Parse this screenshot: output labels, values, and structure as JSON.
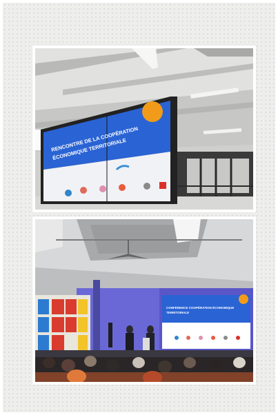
{
  "photos": [
    {
      "name": "conference-screen-photo",
      "screen_text": {
        "badge": "",
        "title_line1": "RENCONTRE DE LA COOPÉRATION",
        "title_line2": "ÉCONOMIQUE TERRITORIALE"
      },
      "colors": {
        "screen_blue": "#2a63d4",
        "badge_orange": "#f29b1a",
        "ceiling": "#d9dad7"
      }
    },
    {
      "name": "conference-hall-photo",
      "screen_text": {
        "title_line1": "CONFÉRENCE COOPÉRATION ÉCONOMIQUE",
        "title_line2": "TERRITORIALE"
      },
      "colors": {
        "stage_purple": "#5a56c8",
        "shelf_red": "#d93b2f",
        "shelf_yellow": "#f2c42a",
        "shelf_blue": "#2c7bd1"
      }
    }
  ]
}
